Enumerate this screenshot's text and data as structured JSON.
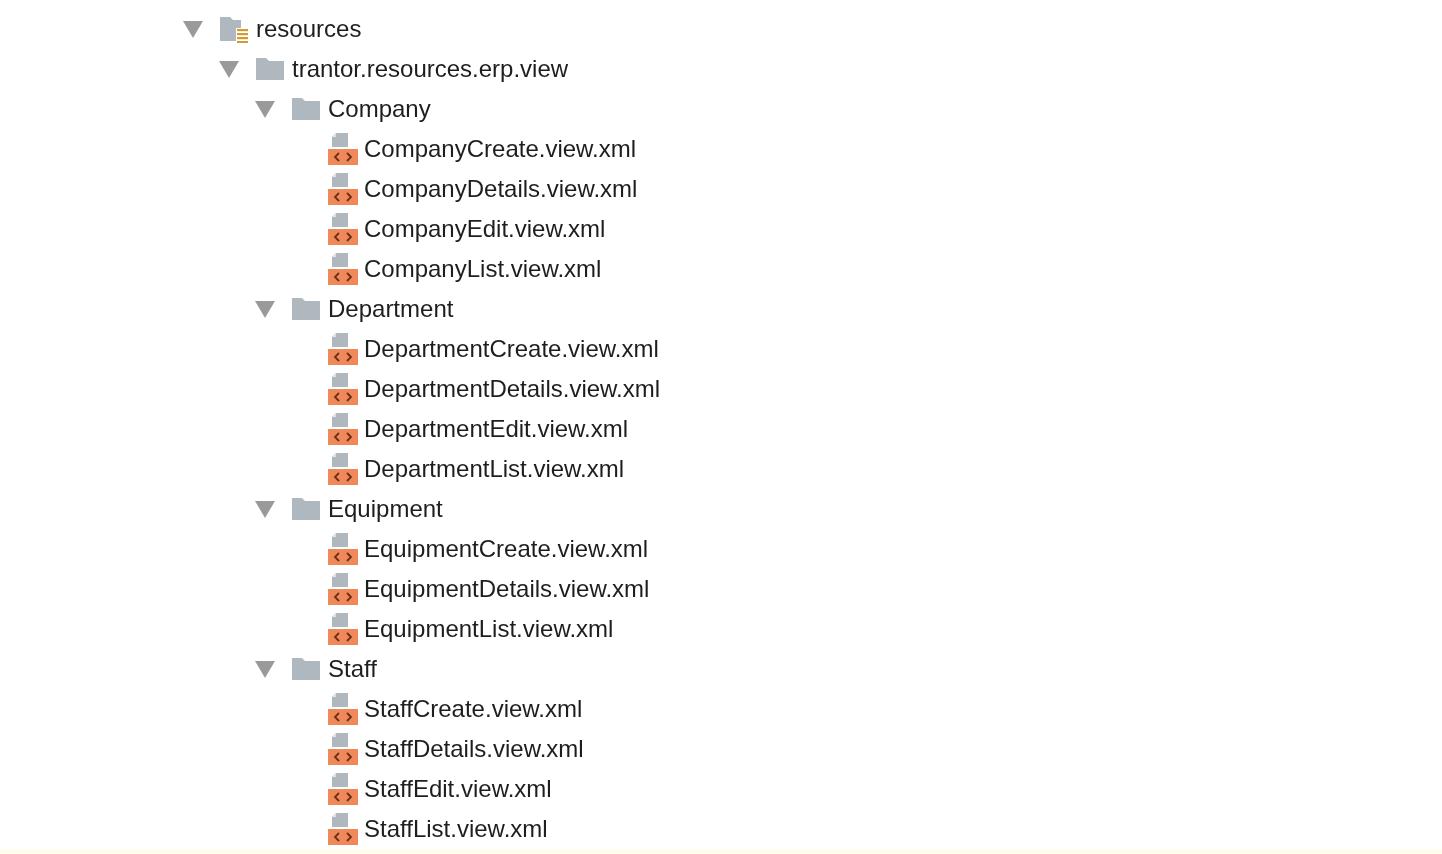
{
  "tree": [
    {
      "label": "resources",
      "kind": "resources",
      "expanded": true,
      "children": [
        {
          "label": "trantor.resources.erp.view",
          "kind": "package",
          "expanded": true,
          "children": [
            {
              "label": "Company",
              "kind": "folder",
              "expanded": true,
              "children": [
                {
                  "label": "CompanyCreate.view.xml",
                  "kind": "xml"
                },
                {
                  "label": "CompanyDetails.view.xml",
                  "kind": "xml"
                },
                {
                  "label": "CompanyEdit.view.xml",
                  "kind": "xml"
                },
                {
                  "label": "CompanyList.view.xml",
                  "kind": "xml"
                }
              ]
            },
            {
              "label": "Department",
              "kind": "folder",
              "expanded": true,
              "children": [
                {
                  "label": "DepartmentCreate.view.xml",
                  "kind": "xml"
                },
                {
                  "label": "DepartmentDetails.view.xml",
                  "kind": "xml"
                },
                {
                  "label": "DepartmentEdit.view.xml",
                  "kind": "xml"
                },
                {
                  "label": "DepartmentList.view.xml",
                  "kind": "xml"
                }
              ]
            },
            {
              "label": "Equipment",
              "kind": "folder",
              "expanded": true,
              "children": [
                {
                  "label": "EquipmentCreate.view.xml",
                  "kind": "xml"
                },
                {
                  "label": "EquipmentDetails.view.xml",
                  "kind": "xml"
                },
                {
                  "label": "EquipmentList.view.xml",
                  "kind": "xml"
                }
              ]
            },
            {
              "label": "Staff",
              "kind": "folder",
              "expanded": true,
              "children": [
                {
                  "label": "StaffCreate.view.xml",
                  "kind": "xml"
                },
                {
                  "label": "StaffDetails.view.xml",
                  "kind": "xml"
                },
                {
                  "label": "StaffEdit.view.xml",
                  "kind": "xml"
                },
                {
                  "label": "StaffList.view.xml",
                  "kind": "xml"
                }
              ]
            }
          ]
        }
      ]
    }
  ]
}
